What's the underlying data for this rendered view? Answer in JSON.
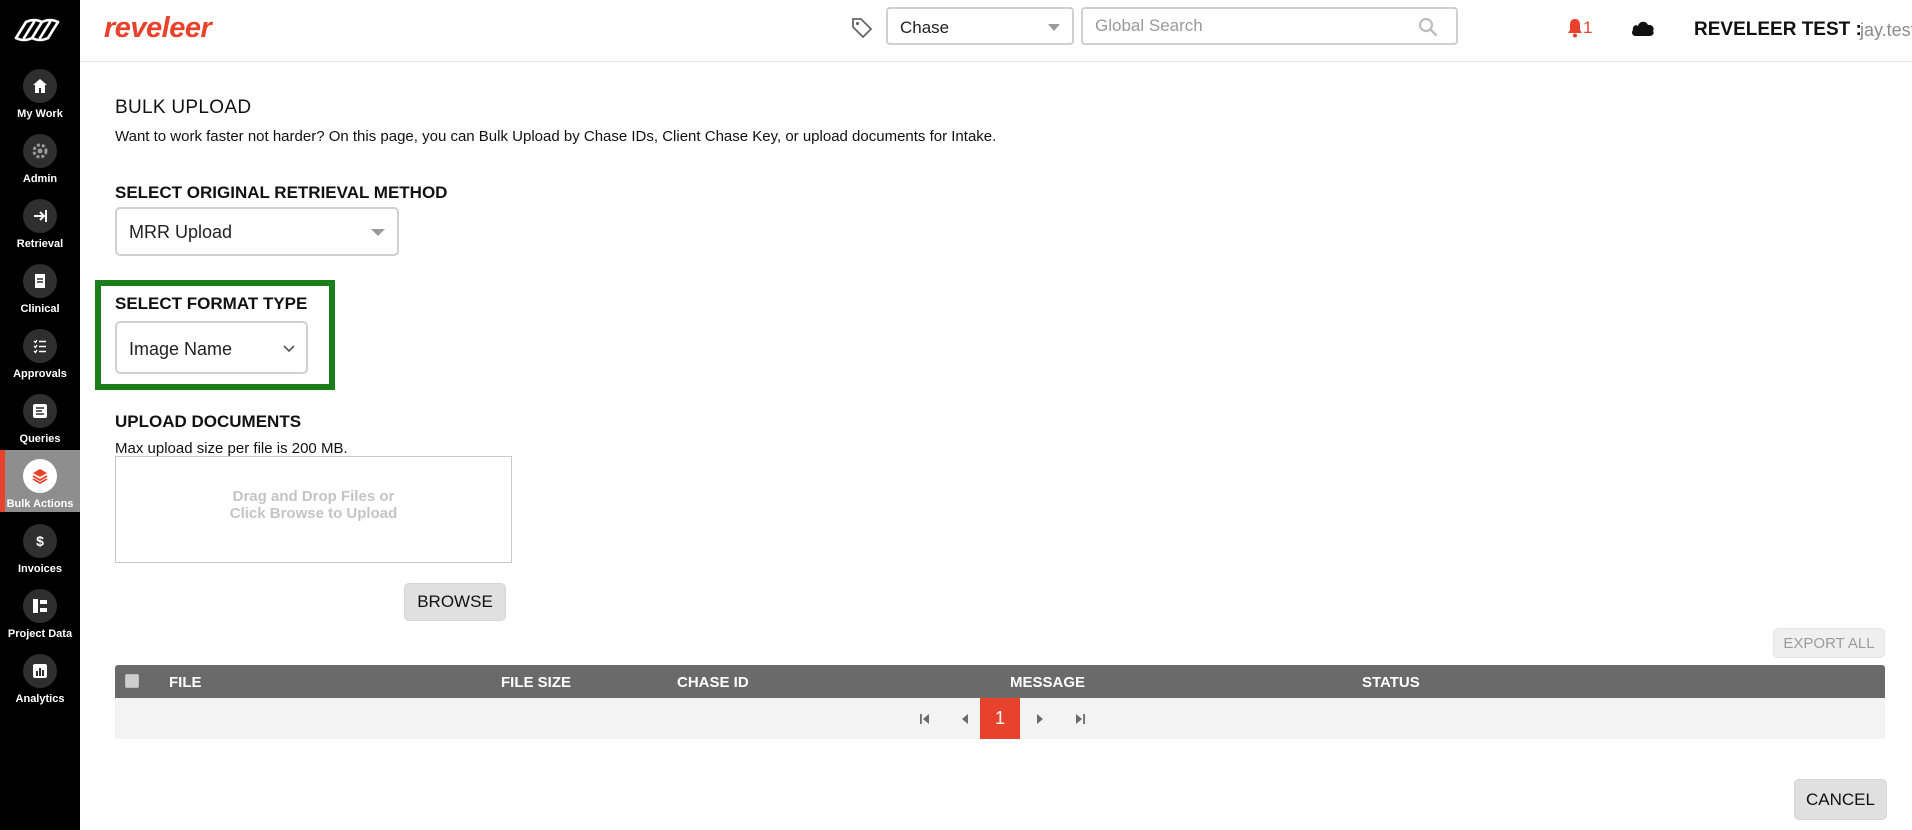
{
  "sidebar": {
    "items": [
      {
        "label": "My Work",
        "icon": "home-icon"
      },
      {
        "label": "Admin",
        "icon": "gear-icon"
      },
      {
        "label": "Retrieval",
        "icon": "arrow-right-icon"
      },
      {
        "label": "Clinical",
        "icon": "document-icon"
      },
      {
        "label": "Approvals",
        "icon": "checklist-icon"
      },
      {
        "label": "Queries",
        "icon": "list-icon"
      },
      {
        "label": "Bulk Actions",
        "icon": "layers-icon"
      },
      {
        "label": "Invoices",
        "icon": "dollar-icon"
      },
      {
        "label": "Project Data",
        "icon": "folder-tree-icon"
      },
      {
        "label": "Analytics",
        "icon": "bar-chart-icon"
      }
    ],
    "active_index": 6
  },
  "header": {
    "brand": "reveleer",
    "search_type": "Chase",
    "search_placeholder": "Global Search",
    "notification_count": "1",
    "user_label": "REVELEER TEST :",
    "user_name": "jay.testing"
  },
  "main": {
    "title": "BULK UPLOAD",
    "description": "Want to work faster not harder? On this page, you can Bulk Upload by Chase IDs, Client Chase Key, or upload documents for Intake.",
    "retrieval_method": {
      "label": "SELECT ORIGINAL RETRIEVAL METHOD",
      "value": "MRR Upload"
    },
    "format_type": {
      "label": "SELECT FORMAT TYPE",
      "value": "Image Name"
    },
    "upload": {
      "label": "UPLOAD DOCUMENTS",
      "note": "Max upload size per file is 200 MB.",
      "drop_line1": "Drag and Drop Files or",
      "drop_line2": "Click Browse to Upload",
      "browse_label": "BROWSE"
    },
    "export_all_label": "EXPORT ALL",
    "table": {
      "columns": [
        "FILE",
        "FILE SIZE",
        "CHASE ID",
        "MESSAGE",
        "STATUS"
      ],
      "current_page": "1"
    },
    "cancel_label": "CANCEL"
  },
  "colors": {
    "accent": "#e8412c",
    "highlight": "#1a7f1a",
    "table_header": "#6a6a6a"
  }
}
